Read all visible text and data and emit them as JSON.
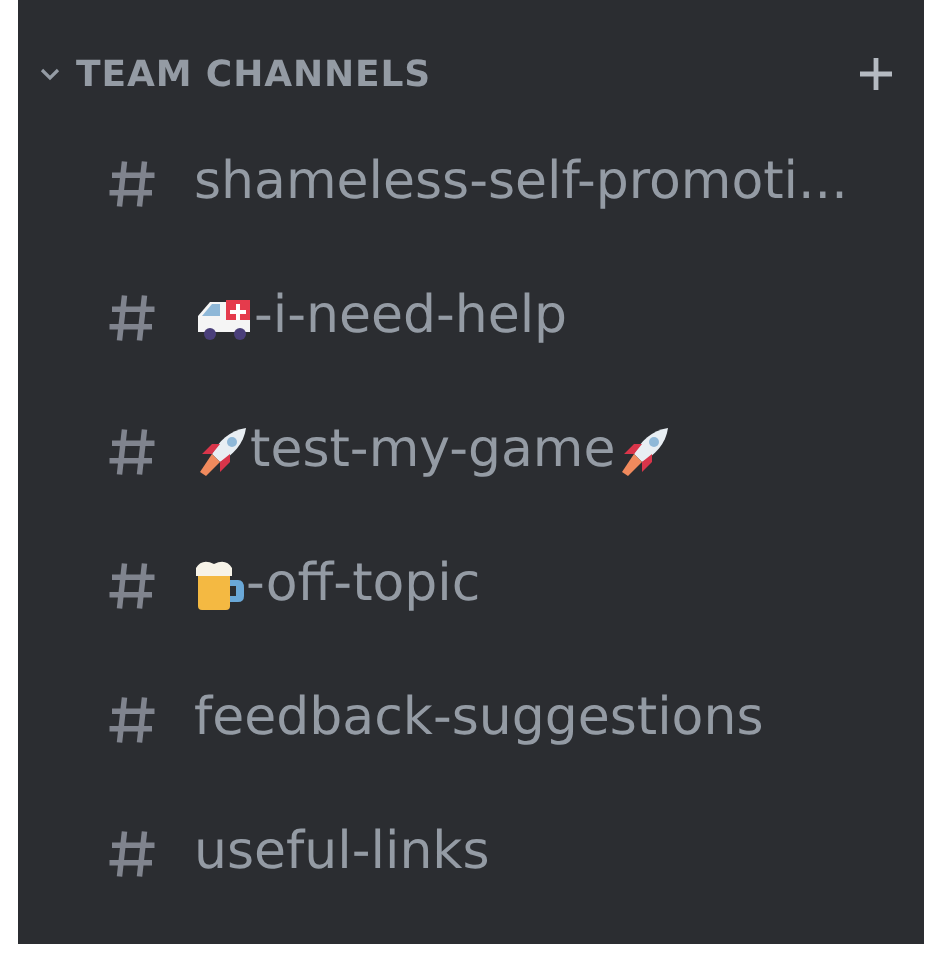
{
  "category": {
    "title": "TEAM CHANNELS",
    "expanded": true
  },
  "channels": [
    {
      "name": "shameless-self-promoti...",
      "kind": "plain"
    },
    {
      "name": "-i-need-help",
      "kind": "prefixed"
    },
    {
      "name": "test-my-game",
      "kind": "wrapped"
    },
    {
      "name": "-off-topic",
      "kind": "prefixed"
    },
    {
      "name": "feedback-suggestions",
      "kind": "plain"
    },
    {
      "name": "useful-links",
      "kind": "plain"
    }
  ]
}
